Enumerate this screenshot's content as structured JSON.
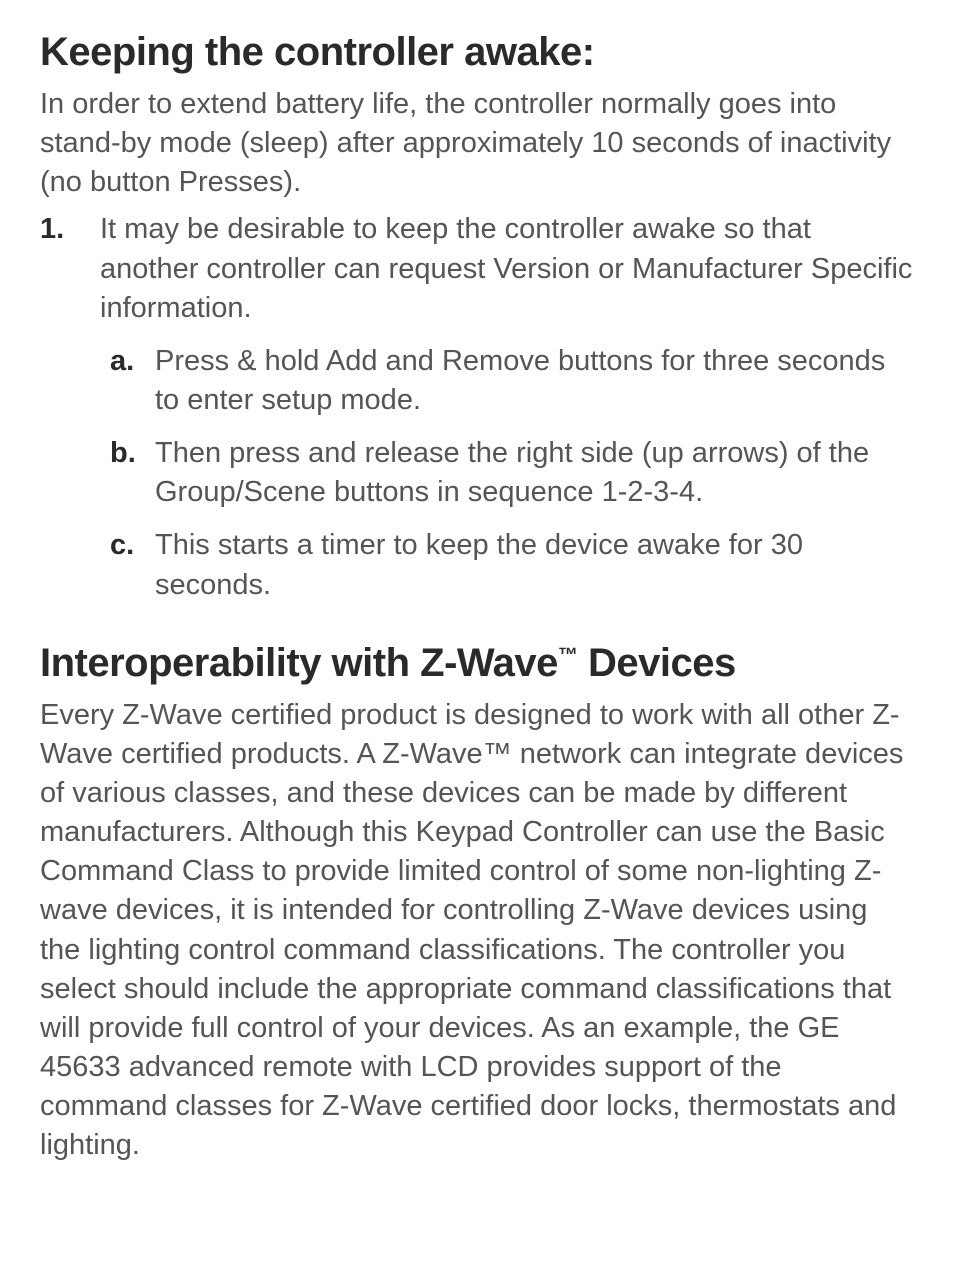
{
  "section1": {
    "heading": "Keeping the controller awake:",
    "intro": "In order to extend battery life, the controller normally goes into stand-by mode (sleep) after approximately 10 seconds of inactivity (no button Presses).",
    "item1": "It may be desirable to keep the controller awake so that another controller can request Version or Manufacturer Specific information.",
    "sub_a": "Press & hold Add and Remove buttons for three seconds to enter setup mode.",
    "sub_b": "Then press and release the right side (up arrows) of the Group/Scene buttons in sequence 1-2-3-4.",
    "sub_c": "This starts a timer to keep the device awake for 30 seconds."
  },
  "section2": {
    "heading_pre": "Interoperability with Z-Wave",
    "heading_tm": "™",
    "heading_post": " Devices",
    "body": "Every Z-Wave certified product is designed to work with all other Z-Wave certified products.  A Z-Wave™ network can integrate devices of various classes, and these devices can be made by different manufacturers. Although this Keypad Controller can use the Basic Command Class to provide limited control of some non-lighting Z-wave devices, it is intended for controlling Z-Wave devices using the lighting control command classifications.  The controller you select should include the appropriate command classifications that will provide full control of your devices.  As an example, the GE 45633 advanced remote with LCD provides support of the command classes for Z-Wave certified door locks, thermostats and lighting."
  }
}
